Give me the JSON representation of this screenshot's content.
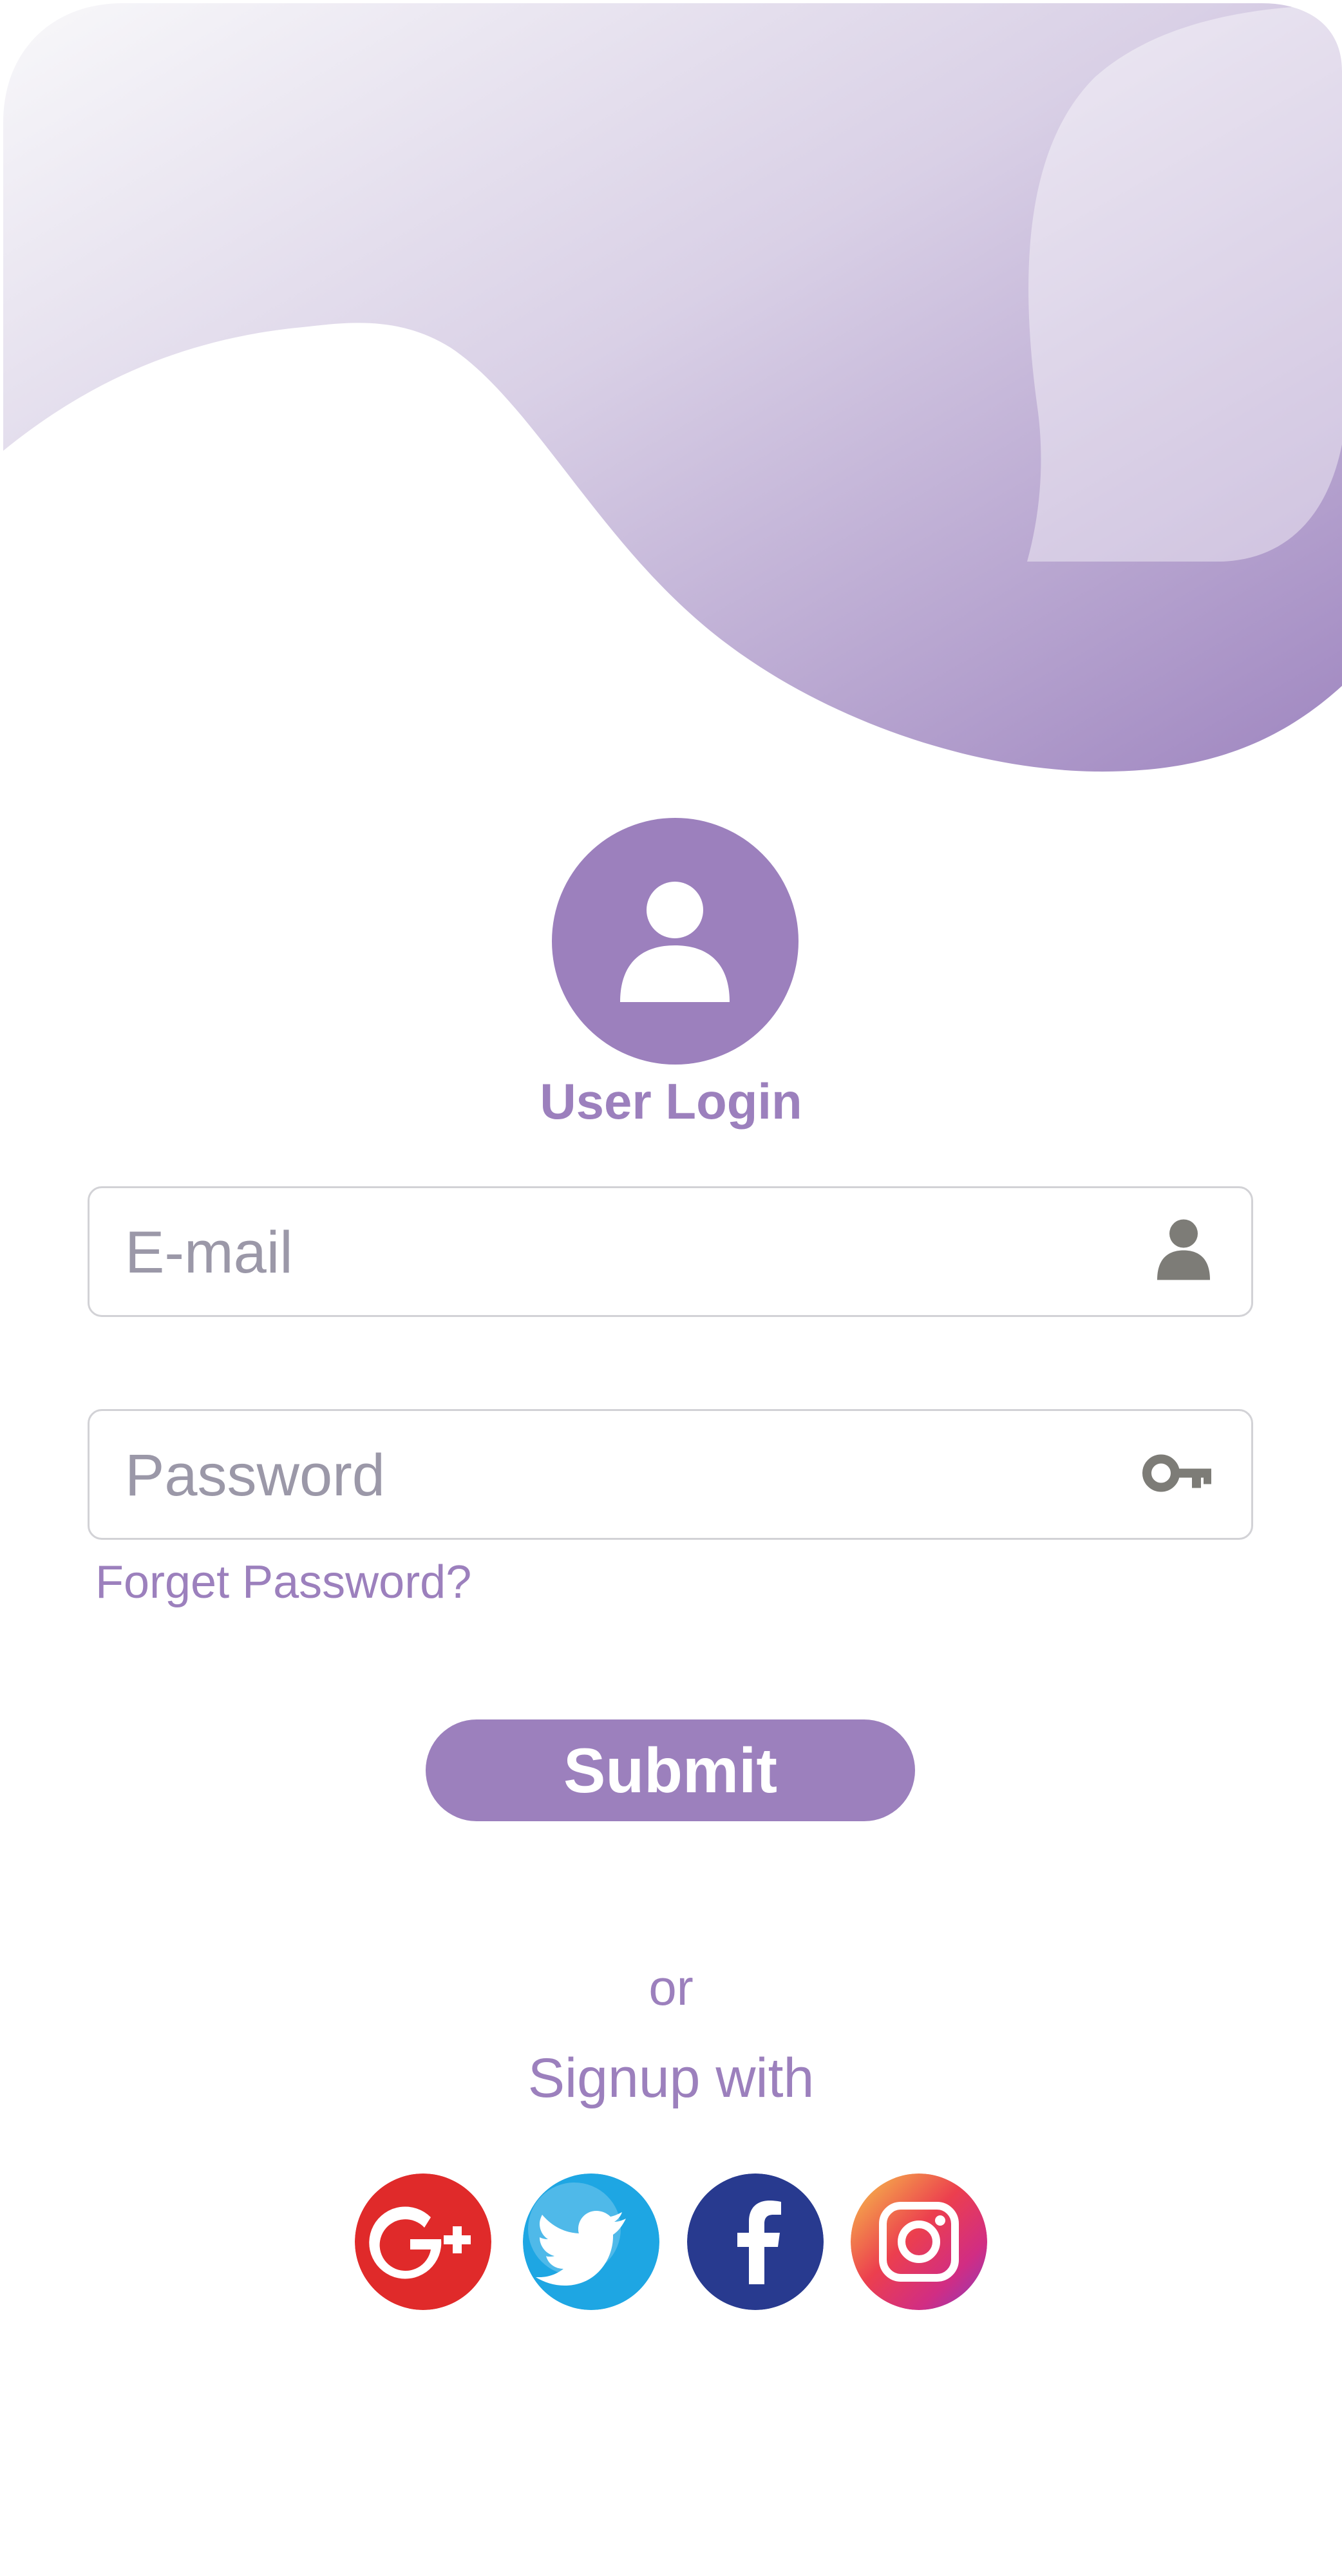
{
  "theme": {
    "accent": "#9c80bd",
    "placeholder_color": "#9b98a8",
    "icon_gray": "#7d7c77",
    "border": "#d2d2d6"
  },
  "header": {
    "avatar_icon": "user-icon",
    "title": "User Login"
  },
  "form": {
    "email": {
      "placeholder": "E-mail",
      "value": "",
      "icon": "person-icon"
    },
    "password": {
      "placeholder": "Password",
      "value": "",
      "icon": "key-icon"
    },
    "forgot_label": "Forget Password?",
    "submit_label": "Submit"
  },
  "signup": {
    "or_label": "or",
    "with_label": "Signup with",
    "providers": [
      {
        "name": "google-plus",
        "icon": "google-plus-icon",
        "color": "#e02a2a"
      },
      {
        "name": "twitter",
        "icon": "twitter-icon",
        "color": "#1ea6e3"
      },
      {
        "name": "facebook",
        "icon": "facebook-icon",
        "color": "#283a8f"
      },
      {
        "name": "instagram",
        "icon": "instagram-icon",
        "color": "#c63a94"
      }
    ]
  }
}
